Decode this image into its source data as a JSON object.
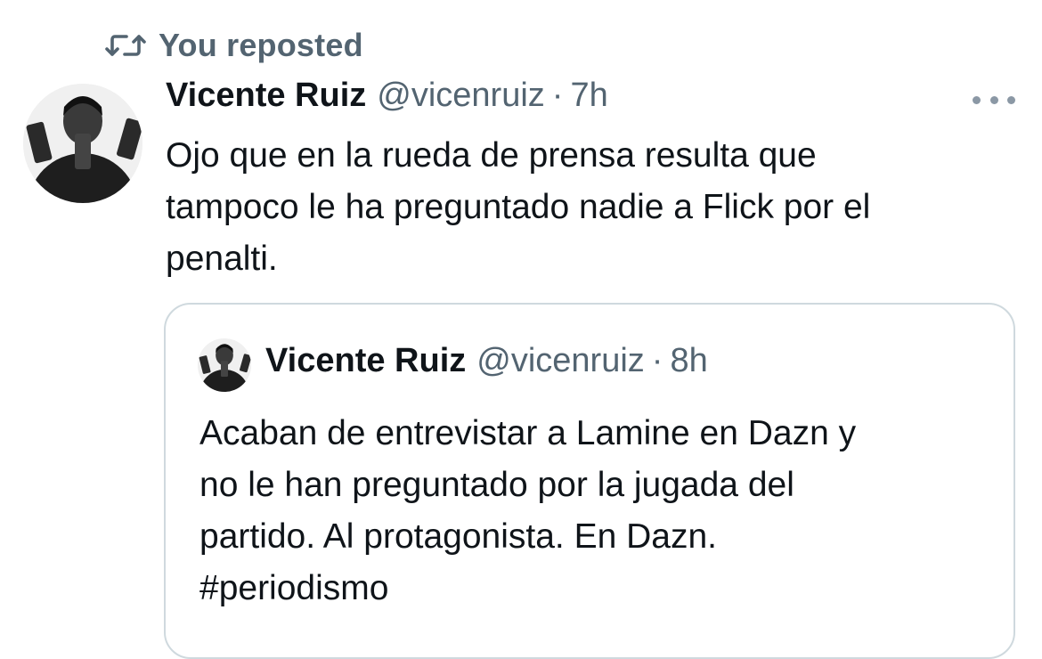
{
  "repost": {
    "label": "You reposted",
    "icon": "repost-icon"
  },
  "tweet": {
    "name": "Vicente Ruiz",
    "handle": "@vicenruiz",
    "separator": "·",
    "time": "7h",
    "text": "Ojo que en la rueda de prensa resulta que\ntampoco le ha preguntado nadie a Flick por el\npenalti.",
    "more_icon": "more-horizontal-icon"
  },
  "quote": {
    "name": "Vicente Ruiz",
    "handle": "@vicenruiz",
    "separator": "·",
    "time": "8h",
    "text": "Acaban de entrevistar a Lamine en Dazn y\nno le han preguntado por la jugada del\npartido. Al protagonista. En Dazn.\n#periodismo"
  },
  "colors": {
    "text_primary": "#0f1419",
    "text_secondary": "#536471",
    "border": "#cfd9de"
  }
}
